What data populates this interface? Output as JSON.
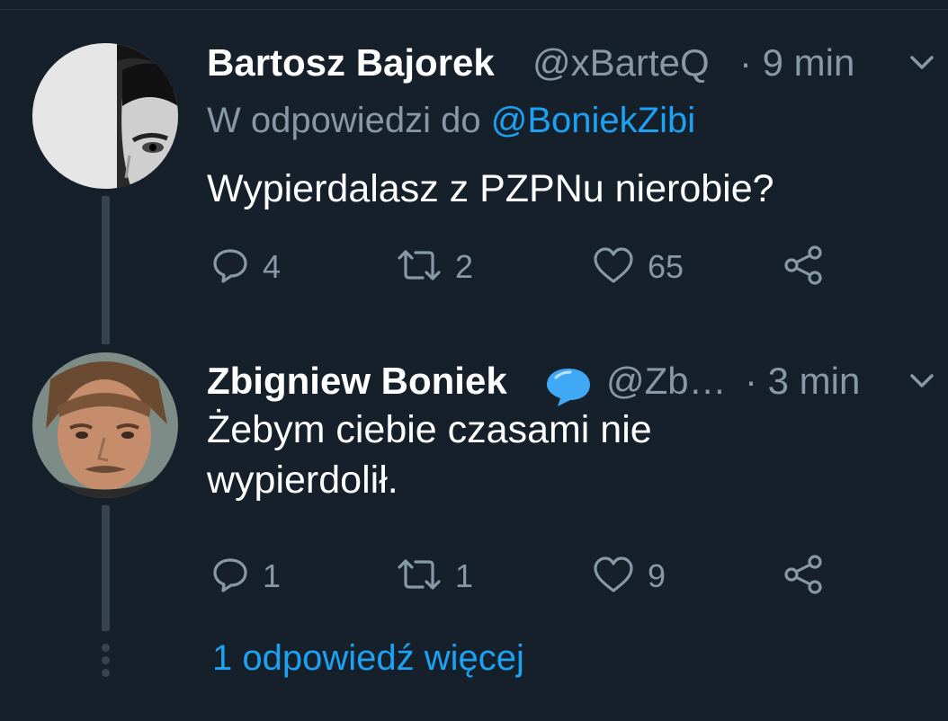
{
  "tweets": [
    {
      "author_name": "Bartosz Bajorek",
      "handle": "@xBarteQ",
      "time": "· 9 min",
      "reply_prefix": "W odpowiedzi do ",
      "reply_mention": "@BoniekZibi",
      "text": "Wypierdalasz z PZPNu nierobie?",
      "reply_count": "4",
      "retweet_count": "2",
      "like_count": "65"
    },
    {
      "author_name": "Zbigniew Boniek",
      "verified_icon": "speech-bubble-emoji",
      "handle": "@Zb…",
      "time": "· 3 min",
      "text_line1": "Żebym ciebie czasami nie",
      "text_line2": "wypierdolił.",
      "reply_count": "1",
      "retweet_count": "1",
      "like_count": "9"
    }
  ],
  "more_replies_label": "1 odpowiedź więcej",
  "colors": {
    "background": "#15202b",
    "primary_text": "#ffffff",
    "secondary_text": "#8899a6",
    "accent": "#1da1f2",
    "thread_line": "#38444d"
  }
}
